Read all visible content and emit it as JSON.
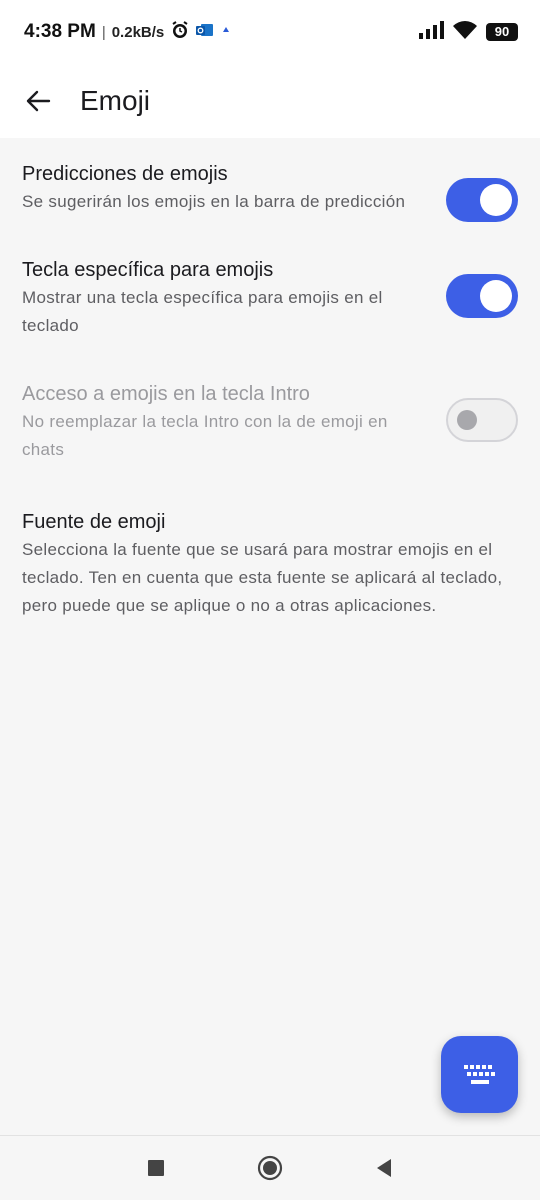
{
  "status_bar": {
    "time": "4:38 PM",
    "separator": "|",
    "speed": "0.2kB/s",
    "battery": "90",
    "icons": [
      "alarm-icon",
      "outlook-icon",
      "notification-dot-icon",
      "signal-icon",
      "wifi-icon",
      "battery-icon"
    ]
  },
  "app_bar": {
    "title": "Emoji",
    "back_icon": "arrow-back-icon"
  },
  "settings": [
    {
      "title": "Predicciones de emojis",
      "description": "Se sugerirán los emojis en la barra de predicción",
      "toggle": "on",
      "enabled": true
    },
    {
      "title": "Tecla específica para emojis",
      "description": "Mostrar una tecla específica para emojis en el teclado",
      "toggle": "on",
      "enabled": true
    },
    {
      "title": "Acceso a emojis en la tecla Intro",
      "description": "No reemplazar la tecla Intro con la de emoji en chats",
      "toggle": "off",
      "enabled": false
    },
    {
      "title": "Fuente de emoji",
      "description": "Selecciona la fuente que se usará para mostrar emojis en el teclado. Ten en cuenta que esta fuente se aplicará al teclado, pero puede que se aplique o no a otras aplicaciones.",
      "enabled": true
    }
  ],
  "fab": {
    "icon": "keyboard-icon"
  },
  "nav_bar": {
    "icons": [
      "recents-square-icon",
      "home-circle-icon",
      "back-triangle-icon"
    ]
  },
  "colors": {
    "accent": "#3d5fe6",
    "background": "#f6f6f6"
  }
}
